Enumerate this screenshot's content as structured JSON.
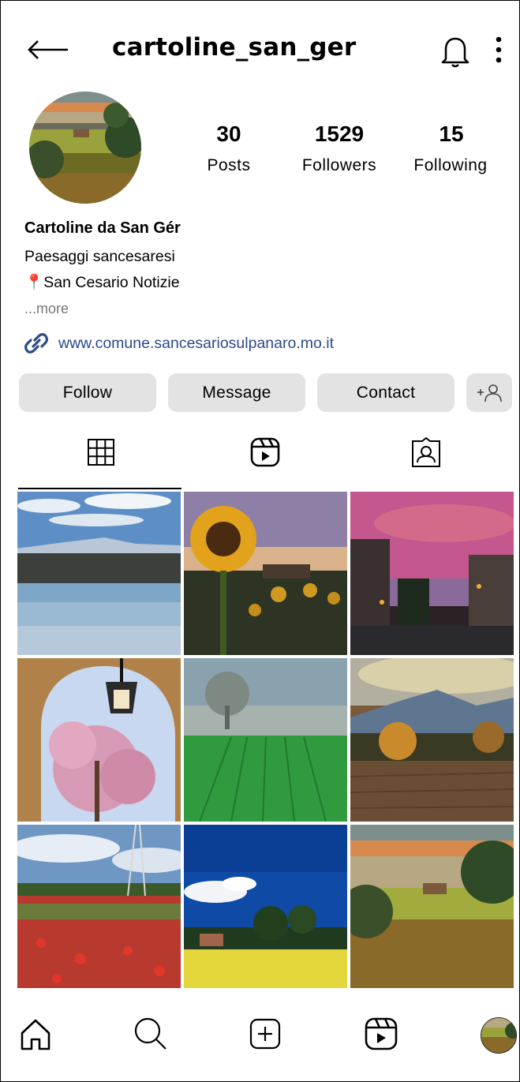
{
  "header": {
    "username": "cartoline_san_ger",
    "back_icon": "back-arrow-icon",
    "bell_icon": "bell-icon",
    "menu_icon": "kebab-menu-icon"
  },
  "stats": [
    {
      "value": "30",
      "label": "Posts"
    },
    {
      "value": "1529",
      "label": "Followers"
    },
    {
      "value": "15",
      "label": "Following"
    }
  ],
  "bio": {
    "name": "Cartoline da San Gér",
    "line1": "Paesaggi sancesaresi",
    "line2": "📍San Cesario Notizie",
    "more": "...more",
    "link": "www.comune.sancesariosulpanaro.mo.it"
  },
  "actions": {
    "follow": "Follow",
    "message": "Message",
    "contact": "Contact",
    "suggest_icon": "add-person-icon"
  },
  "tabs": [
    "grid-icon",
    "reels-icon",
    "tagged-icon"
  ],
  "grid_posts": [
    "lake-mountains",
    "sunflower-sunset",
    "pink-sky-village",
    "arch-pink-tree-lantern",
    "foggy-tree-green-field",
    "autumn-mountains-field",
    "poppy-field-pylon",
    "yellow-field-blue-sky",
    "hills-farmhouse-sunset"
  ],
  "bottom_nav": [
    "home-icon",
    "search-icon",
    "new-post-icon",
    "reels-icon",
    "profile-avatar"
  ],
  "colors": {
    "button_bg": "#e3e3e3",
    "link": "#2a4a8a",
    "more_text": "#777777"
  }
}
